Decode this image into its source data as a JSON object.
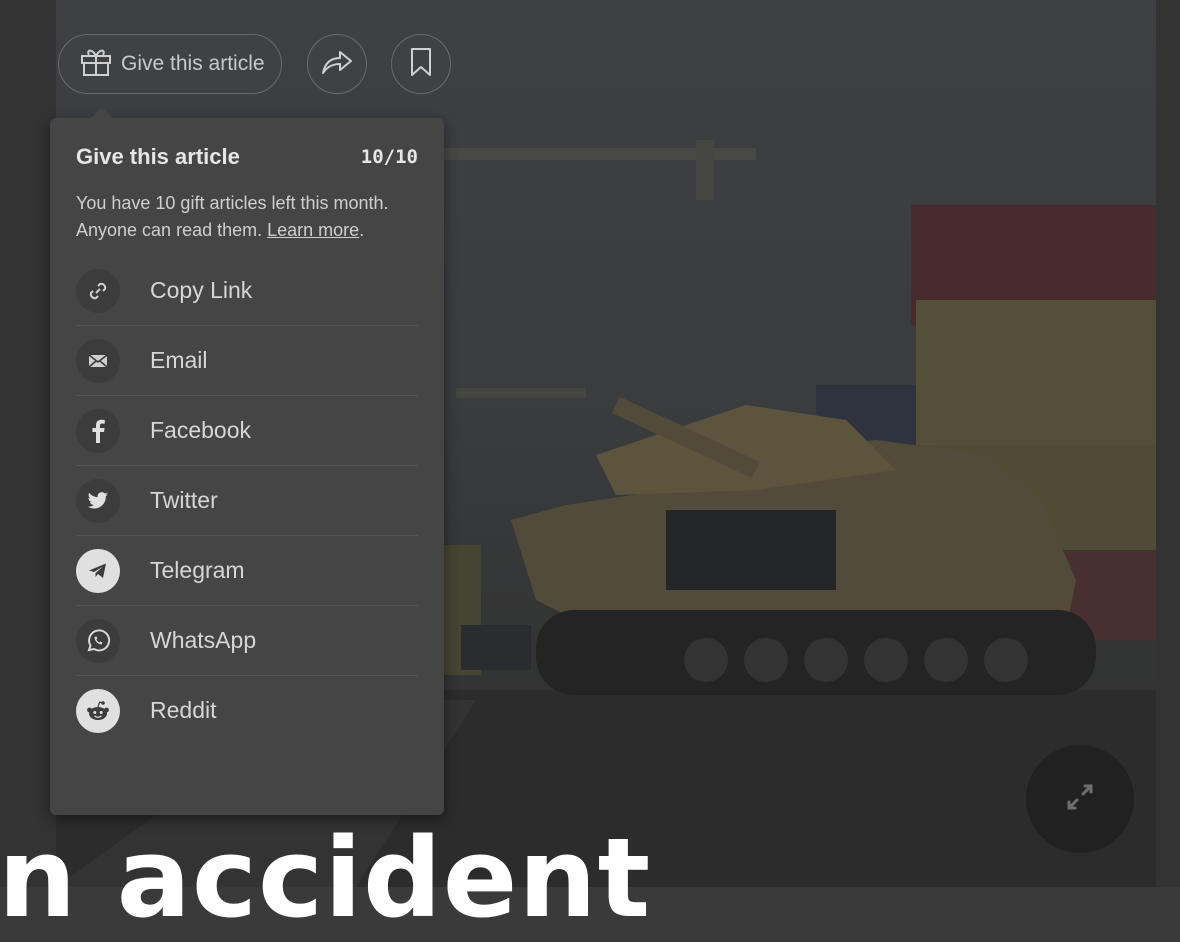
{
  "toolbar": {
    "gift_label": "Give this article"
  },
  "popover": {
    "title": "Give this article",
    "count": "10/10",
    "description": "You have 10 gift articles left this month. Anyone can read them.",
    "learn_more": "Learn more",
    "items": [
      {
        "label": "Copy Link",
        "icon": "link-icon"
      },
      {
        "label": "Email",
        "icon": "email-icon"
      },
      {
        "label": "Facebook",
        "icon": "facebook-icon"
      },
      {
        "label": "Twitter",
        "icon": "twitter-icon"
      },
      {
        "label": "Telegram",
        "icon": "telegram-icon"
      },
      {
        "label": "WhatsApp",
        "icon": "whatsapp-icon"
      },
      {
        "label": "Reddit",
        "icon": "reddit-icon"
      }
    ]
  },
  "headline": {
    "fragment": "n accident"
  },
  "colors": {
    "overlay": "#3a3a3a",
    "popover_bg": "#454545"
  }
}
